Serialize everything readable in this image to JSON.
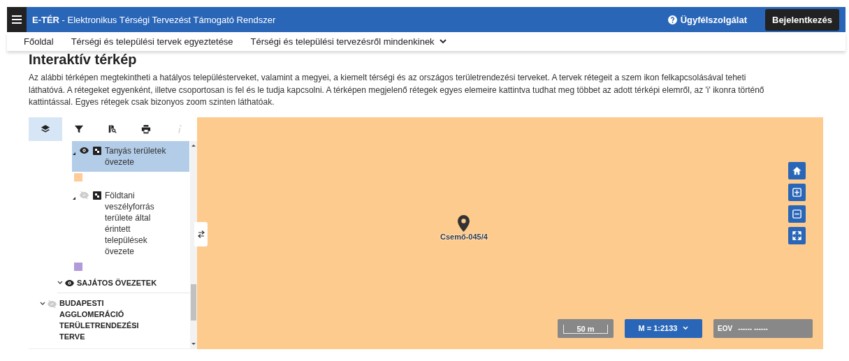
{
  "header": {
    "title": "**E-TÉR** - Elektronikus Térségi Tervezést Támogató Rendszer",
    "support": "Ügyfélszolgálat",
    "login": "Bejelentkezés"
  },
  "nav": [
    {
      "label": "Főoldal",
      "dropdown": false
    },
    {
      "label": "Térségi és települési tervek egyeztetése",
      "dropdown": false
    },
    {
      "label": "Térségi és települési tervezésről mindenkinek",
      "dropdown": true
    }
  ],
  "page_title": "Interaktív térkép",
  "intro": "Az alábbi térképen megtekintheti a hatályos településterveket, valamint a megyei, a kiemelt térségi és az országos területrendezési terveket. A tervek rétegeit a szem ikon felkapcsolásával teheti láthatóvá. A rétegeket egyenként, illetve csoportosan is fel és le tudja kapcsolni. A térképen megjelenő rétegek egyes elemeire kattintva tudhat meg többet az adott térképi elemről, az 'i' ikonra történő kattintással. Egyes rétegek csak bizonyos zoom szinten láthatóak.",
  "tools": [
    {
      "kind": "layers",
      "selected": true,
      "disabled": false
    },
    {
      "kind": "filter",
      "selected": false,
      "disabled": false
    },
    {
      "kind": "map-search",
      "selected": false,
      "disabled": false
    },
    {
      "kind": "print",
      "selected": false,
      "disabled": false
    },
    {
      "kind": "info",
      "selected": false,
      "disabled": true
    }
  ],
  "tree": [
    {
      "kind": "layer",
      "label": "Tanyás területek övezete",
      "visible": true,
      "selected": true,
      "color": "#ffcc99"
    },
    {
      "kind": "layer",
      "label": "Földtani veszélyforrás területe által érintett települések övezete",
      "visible": false,
      "selected": false,
      "color": "#b19cd9"
    },
    {
      "kind": "subgroup",
      "label": "SAJÁTOS ÖVEZETEK",
      "visible": true,
      "expanded": true
    },
    {
      "kind": "group",
      "label": "BUDAPESTI AGGLOMERÁCIÓ TERÜLETRENDEZÉSI TERVE",
      "visible": false,
      "expanded": true
    }
  ],
  "map": {
    "marker_label": "Csemő-045/4",
    "controls": [
      {
        "kind": "home"
      },
      {
        "kind": "zoom-in"
      },
      {
        "kind": "zoom-out"
      },
      {
        "kind": "fullscreen"
      }
    ],
    "scale": "50 m",
    "scale_select": "M = 1:2133",
    "coords_label": "EOV",
    "coords_value": "------ ------"
  }
}
